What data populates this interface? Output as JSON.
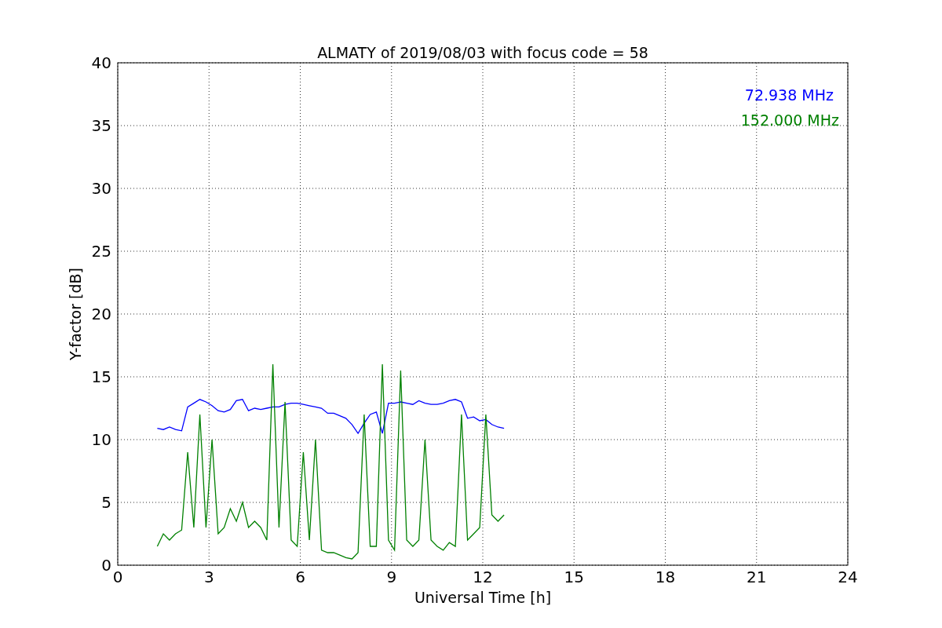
{
  "chart_data": {
    "type": "line",
    "title": "ALMATY of 2019/08/03 with focus code = 58",
    "xlabel": "Universal Time [h]",
    "ylabel": "Y-factor [dB]",
    "grid": true,
    "xlim": [
      0,
      24
    ],
    "ylim": [
      0,
      40
    ],
    "xticks": [
      0,
      3,
      6,
      9,
      12,
      15,
      18,
      21,
      24
    ],
    "yticks": [
      0,
      5,
      10,
      15,
      20,
      25,
      30,
      35,
      40
    ],
    "x": [
      1.3,
      1.5,
      1.7,
      1.9,
      2.1,
      2.3,
      2.5,
      2.7,
      2.9,
      3.1,
      3.3,
      3.5,
      3.7,
      3.9,
      4.1,
      4.3,
      4.5,
      4.7,
      4.9,
      5.1,
      5.3,
      5.5,
      5.7,
      5.9,
      6.1,
      6.3,
      6.5,
      6.7,
      6.9,
      7.1,
      7.3,
      7.5,
      7.7,
      7.9,
      8.1,
      8.3,
      8.5,
      8.7,
      8.9,
      9.1,
      9.3,
      9.5,
      9.7,
      9.9,
      10.1,
      10.3,
      10.5,
      10.7,
      10.9,
      11.1,
      11.3,
      11.5,
      11.7,
      11.9,
      12.1,
      12.3,
      12.5,
      12.7
    ],
    "series": [
      {
        "name": "72.938 MHz",
        "color": "#0000ff",
        "values": [
          10.9,
          10.8,
          11.0,
          10.8,
          10.7,
          12.6,
          12.9,
          13.2,
          13.0,
          12.7,
          12.3,
          12.2,
          12.4,
          13.1,
          13.2,
          12.3,
          12.5,
          12.4,
          12.5,
          12.6,
          12.6,
          12.8,
          12.9,
          12.9,
          12.8,
          12.7,
          12.6,
          12.5,
          12.1,
          12.1,
          11.9,
          11.7,
          11.2,
          10.5,
          11.3,
          12.0,
          12.2,
          10.5,
          12.9,
          12.9,
          13.0,
          12.9,
          12.8,
          13.1,
          12.9,
          12.8,
          12.8,
          12.9,
          13.1,
          13.2,
          13.0,
          11.7,
          11.8,
          11.5,
          11.6,
          11.2,
          11.0,
          10.9
        ]
      },
      {
        "name": "152.000 MHz",
        "color": "#008000",
        "values": [
          1.5,
          2.5,
          2.0,
          2.5,
          2.8,
          9.0,
          3.0,
          12.0,
          3.0,
          10.0,
          2.5,
          3.0,
          4.5,
          3.5,
          5.0,
          3.0,
          3.5,
          3.0,
          2.0,
          16.0,
          3.0,
          13.0,
          2.0,
          1.5,
          9.0,
          2.0,
          10.0,
          1.2,
          1.0,
          1.0,
          0.8,
          0.6,
          0.5,
          1.0,
          12.0,
          1.5,
          1.5,
          16.0,
          2.0,
          1.2,
          15.5,
          2.0,
          1.5,
          2.0,
          10.0,
          2.0,
          1.5,
          1.2,
          1.8,
          1.5,
          12.0,
          2.0,
          2.5,
          3.0,
          12.0,
          4.0,
          3.5,
          4.0
        ]
      }
    ]
  }
}
